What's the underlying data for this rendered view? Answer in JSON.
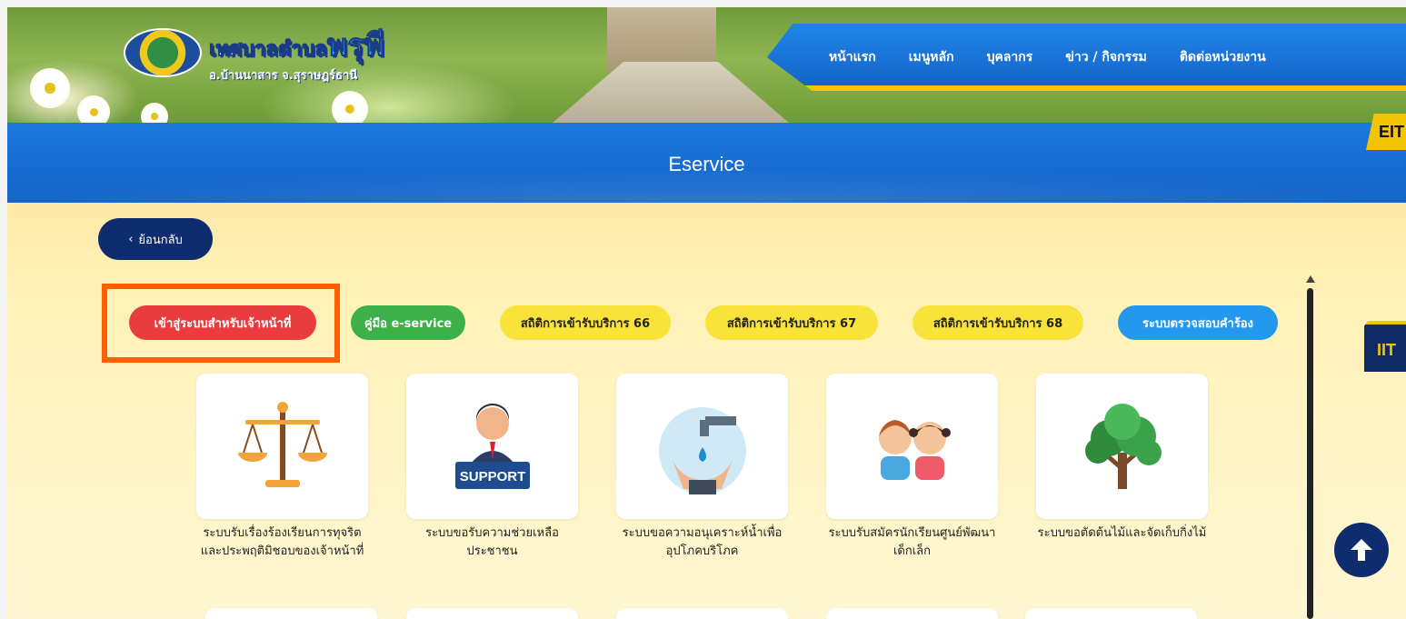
{
  "header": {
    "logo_main_small": "เทศบาลตำบล",
    "logo_main_big": "พรุพี",
    "logo_sub": "อ.บ้านนาสาร จ.สุราษฎร์ธานี",
    "nav": [
      "หน้าแรก",
      "เมนูหลัก",
      "บุคลากร",
      "ข่าว / กิจกรรม",
      "ติดต่อหน่วยงาน"
    ],
    "eit_label": "EIT"
  },
  "page": {
    "title": "Eservice",
    "back_label": "ย้อนกลับ"
  },
  "pills": [
    {
      "label": "เข้าสู่ระบบสำหรับเจ้าหน้าที่",
      "color": "#ea3c3f"
    },
    {
      "label": "คู่มือ e-service",
      "color": "#3db04a"
    },
    {
      "label": "สถิติการเข้ารับบริการ 66",
      "color": "#f9e33a"
    },
    {
      "label": "สถิติการเข้ารับบริการ 67",
      "color": "#f9e33a"
    },
    {
      "label": "สถิติการเข้ารับบริการ 68",
      "color": "#f9e33a"
    },
    {
      "label": "ระบบตรวจสอบคำร้อง",
      "color": "#2498ee"
    }
  ],
  "services": [
    {
      "icon": "scales-icon",
      "label": "ระบบรับเรื่องร้องเรียนการทุจริตและประพฤติมิชอบของเจ้าหน้าที่"
    },
    {
      "icon": "support-agent-icon",
      "label": "ระบบขอรับความช่วยเหลือประชาชน",
      "icon_text": "SUPPORT"
    },
    {
      "icon": "water-tap-icon",
      "label": "ระบบขอความอนุเคราะห์น้ำเพื่ออุปโภคบริโภค"
    },
    {
      "icon": "children-icon",
      "label": "ระบบรับสมัครนักเรียนศูนย์พัฒนาเด็กเล็ก"
    },
    {
      "icon": "tree-icon",
      "label": "ระบบขอตัดต้นไม้และจัดเก็บกิ่งไม้"
    }
  ],
  "side": {
    "itt_label": "IIT"
  },
  "colors": {
    "primary_blue": "#1565c9",
    "navy": "#0f2d6e",
    "highlight_orange": "#ff5f00"
  }
}
